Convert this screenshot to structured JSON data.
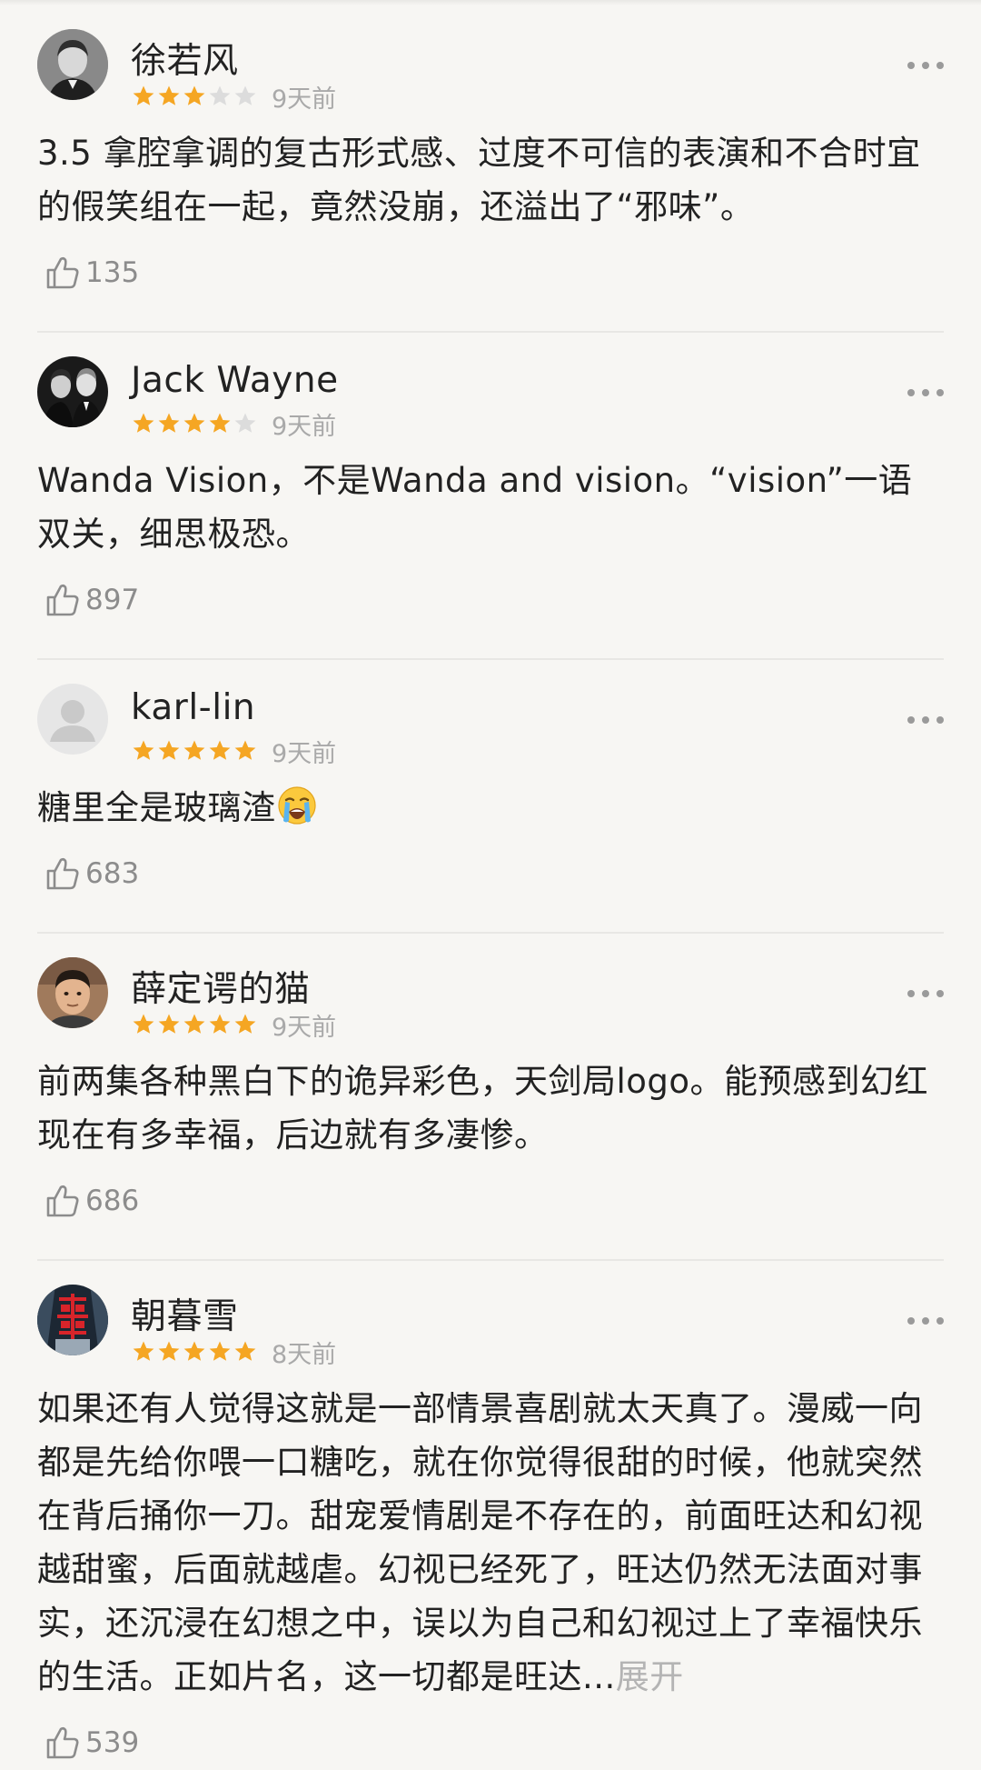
{
  "reviews": [
    {
      "user": "徐若风",
      "rating": 3,
      "max_rating": 5,
      "time": "9天前",
      "text": "3.5  拿腔拿调的复古形式感、过度不可信的表演和不合时宜的假笑组在一起，竟然没崩，还溢出了“邪味”。",
      "likes": "135",
      "avatar": "bw-portrait-boy"
    },
    {
      "user": "Jack Wayne",
      "rating": 4,
      "max_rating": 5,
      "time": "9天前",
      "text": "Wanda Vision，不是Wanda and vision。“vision”一语双关，细思极恐。",
      "likes": "897",
      "avatar": "bw-two-men"
    },
    {
      "user": "karl-lin",
      "rating": 5,
      "max_rating": 5,
      "time": "9天前",
      "text": "糖里全是玻璃渣",
      "emoji": "loudly-crying-face",
      "likes": "683",
      "avatar": "default-user"
    },
    {
      "user": "薛定谔的猫",
      "rating": 5,
      "max_rating": 5,
      "time": "9天前",
      "text": "前两集各种黑白下的诡异彩色，天剑局logo。能预感到幻红现在有多幸福，后边就有多凄惨。",
      "likes": "686",
      "avatar": "man-photo"
    },
    {
      "user": "朝暮雪",
      "rating": 5,
      "max_rating": 5,
      "time": "8天前",
      "text": "如果还有人觉得这就是一部情景喜剧就太天真了。漫威一向都是先给你喂一口糖吃，就在你觉得很甜的时候，他就突然在背后捅你一刀。甜宠爱情剧是不存在的，前面旺达和幻视越甜蜜，后面就越虐。幻视已经死了，旺达仍然无法面对事实，还沉浸在幻想之中，误以为自己和幻视过上了幸福快乐的生活。正如片名，这一切都是旺达...",
      "expand": "展开",
      "likes": "539",
      "avatar": "red-double-happiness"
    }
  ],
  "colors": {
    "star_filled": "#f5a623",
    "star_empty": "#dcdcdc",
    "text": "#222222",
    "muted": "#a9a9a9",
    "background": "#f7f6f3"
  },
  "icons": {
    "like": "thumbs-up-icon",
    "more": "more-dots-icon",
    "star": "star-icon"
  }
}
